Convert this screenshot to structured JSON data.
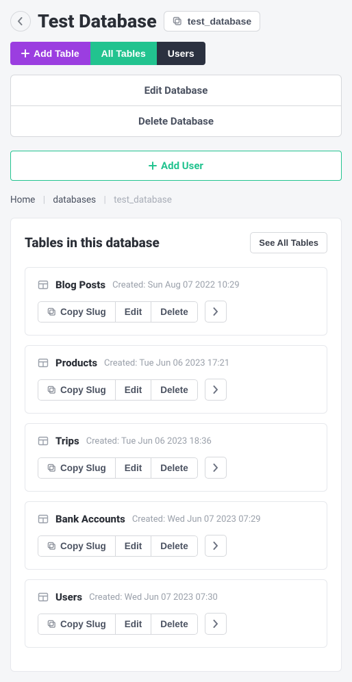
{
  "header": {
    "title": "Test Database",
    "slug": "test_database"
  },
  "tabs": {
    "add_table": "Add Table",
    "all_tables": "All Tables",
    "users": "Users"
  },
  "actions": {
    "edit_db": "Edit Database",
    "delete_db": "Delete Database",
    "add_user": "Add User"
  },
  "breadcrumbs": {
    "home": "Home",
    "databases": "databases",
    "current": "test_database"
  },
  "section": {
    "title": "Tables in this database",
    "see_all": "See All Tables"
  },
  "item_buttons": {
    "copy_slug": "Copy Slug",
    "edit": "Edit",
    "delete": "Delete"
  },
  "tables": [
    {
      "name": "Blog Posts",
      "created": "Created: Sun Aug 07 2022 10:29"
    },
    {
      "name": "Products",
      "created": "Created: Tue Jun 06 2023 17:21"
    },
    {
      "name": "Trips",
      "created": "Created: Tue Jun 06 2023 18:36"
    },
    {
      "name": "Bank Accounts",
      "created": "Created: Wed Jun 07 2023 07:29"
    },
    {
      "name": "Users",
      "created": "Created: Wed Jun 07 2023 07:30"
    }
  ]
}
